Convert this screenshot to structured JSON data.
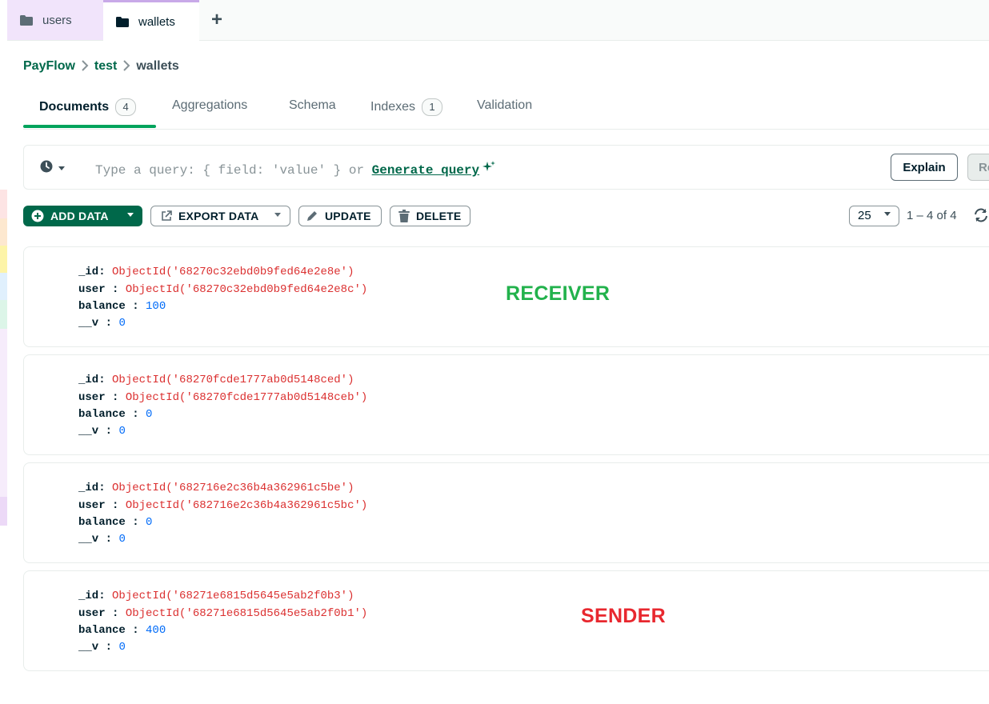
{
  "tabs": [
    {
      "label": "users"
    },
    {
      "label": "wallets"
    }
  ],
  "breadcrumb": [
    "PayFlow",
    "test",
    "wallets"
  ],
  "collection_tabs": [
    {
      "label": "Documents",
      "count": "4"
    },
    {
      "label": "Aggregations"
    },
    {
      "label": "Schema"
    },
    {
      "label": "Indexes",
      "count": "1"
    },
    {
      "label": "Validation"
    }
  ],
  "query": {
    "placeholder": "Type a query: { field: 'value' } or",
    "generate_label": "Generate query",
    "explain_label": "Explain",
    "reset_label": "Re"
  },
  "toolbar": {
    "add_data": "ADD DATA",
    "export_data": "EXPORT DATA",
    "update": "UPDATE",
    "delete": "DELETE",
    "page_size": "25",
    "range": "1 – 4 of 4"
  },
  "documents": [
    {
      "id_label": "_id",
      "id": "ObjectId('68270c32ebd0b9fed64e2e8e')",
      "user_label": "user",
      "user": "ObjectId('68270c32ebd0b9fed64e2e8c')",
      "balance_label": "balance",
      "balance": "100",
      "v_label": "__v",
      "v": "0"
    },
    {
      "id_label": "_id",
      "id": "ObjectId('68270fcde1777ab0d5148ced')",
      "user_label": "user",
      "user": "ObjectId('68270fcde1777ab0d5148ceb')",
      "balance_label": "balance",
      "balance": "0",
      "v_label": "__v",
      "v": "0"
    },
    {
      "id_label": "_id",
      "id": "ObjectId('682716e2c36b4a362961c5be')",
      "user_label": "user",
      "user": "ObjectId('682716e2c36b4a362961c5bc')",
      "balance_label": "balance",
      "balance": "0",
      "v_label": "__v",
      "v": "0"
    },
    {
      "id_label": "_id",
      "id": "ObjectId('68271e6815d5645e5ab2f0b3')",
      "user_label": "user",
      "user": "ObjectId('68271e6815d5645e5ab2f0b1')",
      "balance_label": "balance",
      "balance": "400",
      "v_label": "__v",
      "v": "0"
    }
  ],
  "annotations": {
    "receiver": "RECEIVER",
    "sender": "SENDER"
  },
  "colors": {
    "brand_green": "#00684a",
    "receiver_annotation": "#22b24c",
    "sender_annotation": "#e8282f",
    "objectid_red": "#db3030",
    "number_blue": "#016bf8"
  }
}
